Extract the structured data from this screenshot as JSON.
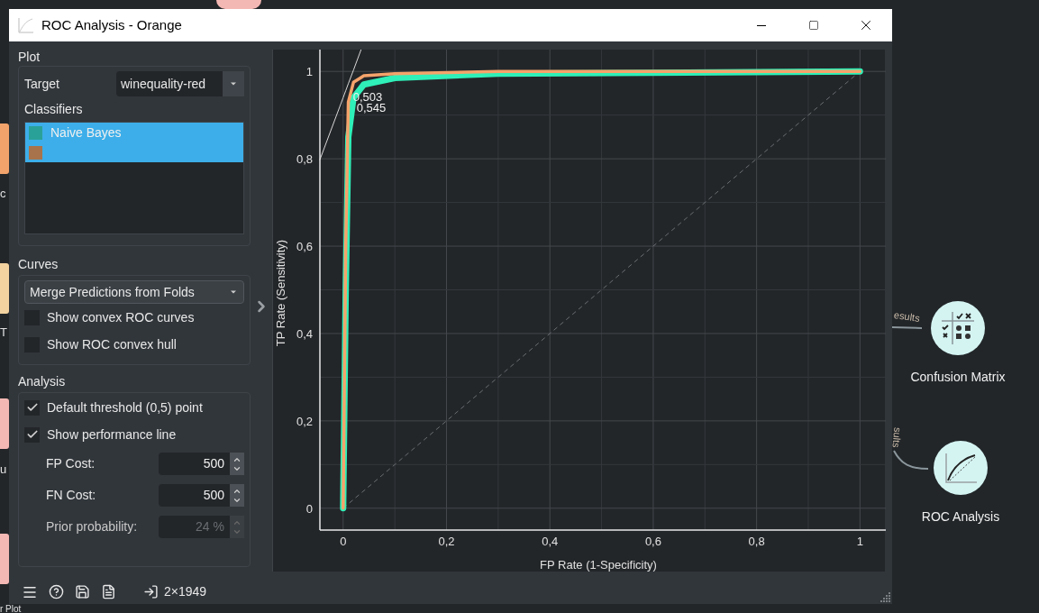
{
  "window": {
    "title": "ROC Analysis - Orange"
  },
  "plot_section": {
    "heading": "Plot",
    "target_label": "Target",
    "target_value": "winequality-red",
    "classifiers_label": "Classifiers",
    "classifiers": [
      {
        "name": "Naive Bayes",
        "color": "#2aa198",
        "selected": true
      },
      {
        "color": "#a8734a",
        "selected": true
      }
    ]
  },
  "curves_section": {
    "heading": "Curves",
    "merge_mode": "Merge Predictions from Folds",
    "options": [
      {
        "label": "Show convex ROC curves",
        "checked": false
      },
      {
        "label": "Show ROC convex hull",
        "checked": false
      }
    ]
  },
  "analysis_section": {
    "heading": "Analysis",
    "options": [
      {
        "label": "Default threshold (0,5) point",
        "checked": true
      },
      {
        "label": "Show performance line",
        "checked": true
      }
    ],
    "fields": [
      {
        "label": "FP Cost:",
        "value": "500",
        "disabled": false
      },
      {
        "label": "FN Cost:",
        "value": "500",
        "disabled": false
      },
      {
        "label": "Prior probability:",
        "value": "24 %",
        "disabled": true
      }
    ]
  },
  "chart_data": {
    "type": "line",
    "xlabel": "FP Rate (1-Specificity)",
    "ylabel": "TP Rate (Sensitivity)",
    "x": [
      -0.045,
      0,
      0.005,
      0.01,
      0.02,
      0.0347,
      0.04,
      0.1,
      0.3,
      1
    ],
    "series": [
      {
        "color": "#2ef0b8",
        "values": [
          null,
          0,
          0.5,
          0.85,
          0.94,
          0.962,
          0.97,
          0.985,
          0.995,
          1
        ]
      },
      {
        "color": "#f5a36b",
        "values": [
          null,
          0,
          0.6,
          0.93,
          0.975,
          0.986,
          0.99,
          0.995,
          1,
          1
        ]
      },
      {
        "color": "#d8d8d8",
        "values": [
          0.798,
          0.94,
          0.956,
          0.972,
          1.003,
          1.05,
          null,
          null,
          null,
          null
        ]
      }
    ],
    "xlim": [
      -0.045,
      1.05
    ],
    "ylim": [
      -0.05,
      1.05
    ],
    "grid": true,
    "xticks": [
      {
        "value": 0,
        "label": "0"
      },
      {
        "value": 0.2,
        "label": "0,2"
      },
      {
        "value": 0.4,
        "label": "0,4"
      },
      {
        "value": 0.6,
        "label": "0,6"
      },
      {
        "value": 0.8,
        "label": "0,8"
      },
      {
        "value": 1,
        "label": "1"
      }
    ],
    "yticks": [
      {
        "value": 0,
        "label": "0"
      },
      {
        "value": 0.2,
        "label": "0,2"
      },
      {
        "value": 0.4,
        "label": "0,4"
      },
      {
        "value": 0.6,
        "label": "0,6"
      },
      {
        "value": 0.8,
        "label": "0,8"
      },
      {
        "value": 1,
        "label": "1"
      }
    ],
    "annotations": [
      {
        "text": "0,503",
        "x": 0.019,
        "y": 0.932
      },
      {
        "text": "0,545",
        "x": 0.026,
        "y": 0.907
      }
    ]
  },
  "status_bar": {
    "data_size": "2×1949"
  },
  "canvas": {
    "widgets": [
      {
        "kind": "confusion",
        "label": "Confusion Matrix"
      },
      {
        "kind": "roc",
        "label": "ROC Analysis"
      }
    ],
    "link_labels": [
      "esults",
      "sults"
    ],
    "partial_labels": [
      "c",
      "T",
      "u",
      "r Plot"
    ]
  }
}
